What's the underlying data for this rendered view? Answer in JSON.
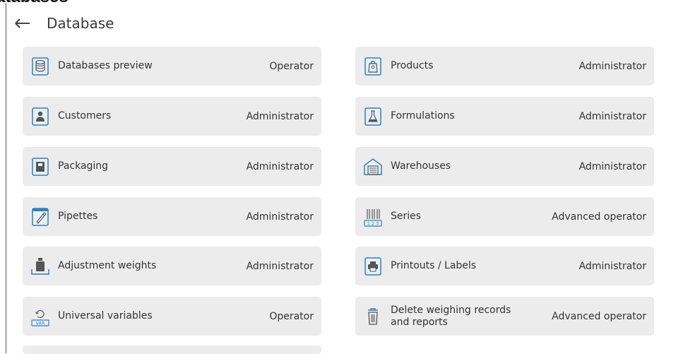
{
  "cutoff_title": "atabases",
  "header": {
    "back_icon": "arrow-left-icon",
    "title": "Database"
  },
  "tiles": [
    {
      "label": "Databases preview",
      "role": "Operator",
      "icon": "database-icon"
    },
    {
      "label": "Products",
      "role": "Administrator",
      "icon": "product-bag-icon"
    },
    {
      "label": "Customers",
      "role": "Administrator",
      "icon": "customer-icon"
    },
    {
      "label": "Formulations",
      "role": "Administrator",
      "icon": "flask-icon"
    },
    {
      "label": "Packaging",
      "role": "Administrator",
      "icon": "packaging-icon"
    },
    {
      "label": "Warehouses",
      "role": "Administrator",
      "icon": "warehouse-icon"
    },
    {
      "label": "Pipettes",
      "role": "Administrator",
      "icon": "pipette-icon"
    },
    {
      "label": "Series",
      "role": "Advanced operator",
      "icon": "series-icon"
    },
    {
      "label": "Adjustment weights",
      "role": "Administrator",
      "icon": "weight-icon"
    },
    {
      "label": "Printouts / Labels",
      "role": "Administrator",
      "icon": "printer-icon"
    },
    {
      "label": "Universal variables",
      "role": "Operator",
      "icon": "variables-icon",
      "icon_text": "VAR"
    },
    {
      "label": "Delete weighing records and reports",
      "role": "Advanced operator",
      "icon": "trash-icon",
      "label_line1": "Delete weighing records",
      "label_line2": "and reports"
    }
  ],
  "series_icon_text": "1 2 3",
  "colors": {
    "tile_bg": "#ececec",
    "icon_blue": "#2f7fc1",
    "icon_dark": "#555555"
  }
}
